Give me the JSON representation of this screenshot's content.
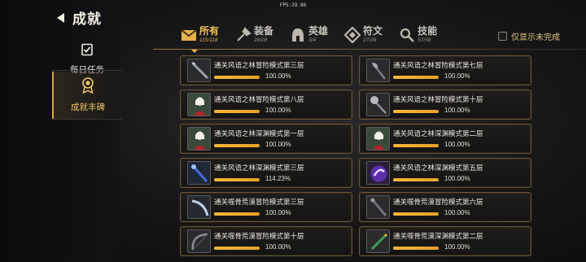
{
  "fps": "FPS:29.86",
  "header": {
    "title": "成就"
  },
  "sidebar": {
    "items": [
      {
        "label": "每日任务",
        "icon": "clipboard-check-icon",
        "active": false
      },
      {
        "label": "成就丰碑",
        "icon": "medal-icon",
        "active": true
      }
    ]
  },
  "tabs": [
    {
      "name": "所有",
      "count": "115/118",
      "icon": "envelope-icon",
      "active": true
    },
    {
      "name": "装备",
      "count": "28/28",
      "icon": "equipment-icon",
      "active": false
    },
    {
      "name": "英雄",
      "count": "3/4",
      "icon": "helmet-icon",
      "active": false
    },
    {
      "name": "符文",
      "count": "27/28",
      "icon": "rune-icon",
      "active": false
    },
    {
      "name": "技能",
      "count": "57/58",
      "icon": "skill-icon",
      "active": false
    }
  ],
  "filter": {
    "label": "仅显示未完成",
    "checked": false
  },
  "achievements": [
    {
      "name": "通关风语之林冒险模式第三层",
      "progress": "100.00%",
      "fill": 1.0,
      "item": "dark-blade-icon"
    },
    {
      "name": "通关风语之林冒险模式第七层",
      "progress": "100.00%",
      "fill": 1.0,
      "item": "axe-icon"
    },
    {
      "name": "通关风语之林冒险模式第八层",
      "progress": "100.00%",
      "fill": 1.0,
      "item": "hero-portrait-icon"
    },
    {
      "name": "通关风语之林冒险模式第十层",
      "progress": "100.00%",
      "fill": 1.0,
      "item": "mace-icon"
    },
    {
      "name": "通关风语之林深渊模式第一层",
      "progress": "100.00%",
      "fill": 1.0,
      "item": "hero-portrait-icon"
    },
    {
      "name": "通关风语之林深渊模式第二层",
      "progress": "100.00%",
      "fill": 1.0,
      "item": "hero-portrait-icon"
    },
    {
      "name": "通关风语之林深渊模式第三层",
      "progress": "114.23%",
      "fill": 1.0,
      "item": "blue-staff-icon"
    },
    {
      "name": "通关风语之林深渊模式第五层",
      "progress": "100.00%",
      "fill": 1.0,
      "item": "purple-orb-icon"
    },
    {
      "name": "通关噬骨荒漠冒险模式第三层",
      "progress": "100.00%",
      "fill": 1.0,
      "item": "curved-blade-icon"
    },
    {
      "name": "通关噬骨荒漠冒险模式第六层",
      "progress": "100.00%",
      "fill": 1.0,
      "item": "dark-staff-icon"
    },
    {
      "name": "通关噬骨荒漠冒险模式第十层",
      "progress": "100.00%",
      "fill": 1.0,
      "item": "bow-icon"
    },
    {
      "name": "通关噬骨荒漠深渊模式第二层",
      "progress": "100.00%",
      "fill": 1.0,
      "item": "green-sword-icon"
    }
  ]
}
